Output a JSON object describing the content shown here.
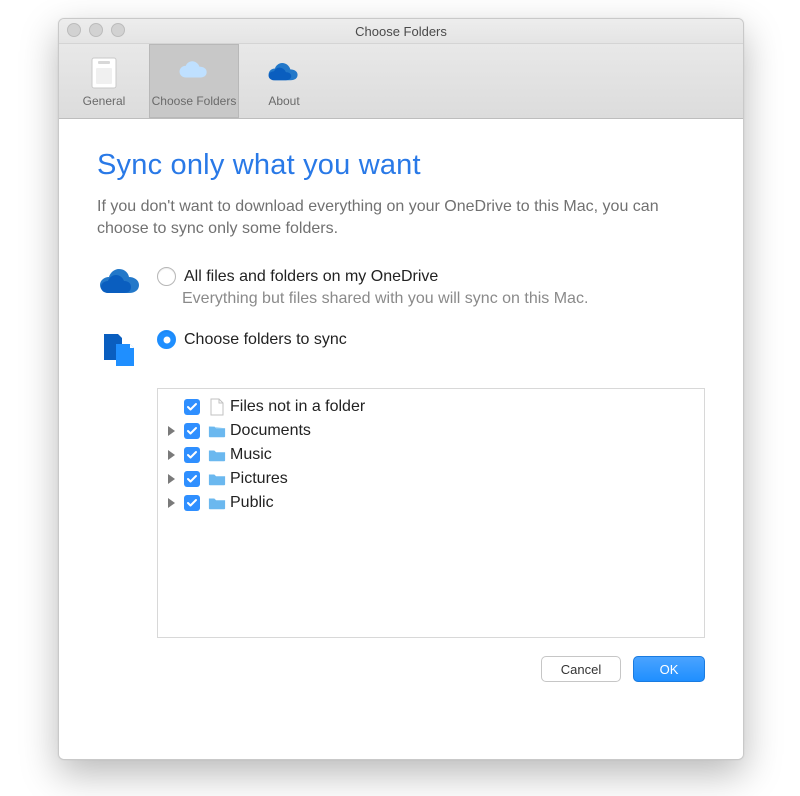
{
  "window": {
    "title": "Choose Folders"
  },
  "toolbar": {
    "tabs": [
      {
        "label": "General"
      },
      {
        "label": "Choose Folders"
      },
      {
        "label": "About"
      }
    ]
  },
  "content": {
    "headline": "Sync only what you want",
    "description": "If you don't want to download everything on your OneDrive to this Mac, you can choose to sync only some folders.",
    "options": {
      "all": {
        "label": "All files and folders on my OneDrive",
        "description": "Everything but files shared with you will sync on this Mac.",
        "selected": false
      },
      "choose": {
        "label": "Choose folders to sync",
        "selected": true
      }
    },
    "tree": [
      {
        "label": "Files not in a folder",
        "expandable": false,
        "checked": true,
        "type": "file"
      },
      {
        "label": "Documents",
        "expandable": true,
        "checked": true,
        "type": "folder"
      },
      {
        "label": "Music",
        "expandable": true,
        "checked": true,
        "type": "folder"
      },
      {
        "label": "Pictures",
        "expandable": true,
        "checked": true,
        "type": "folder"
      },
      {
        "label": "Public",
        "expandable": true,
        "checked": true,
        "type": "folder"
      }
    ]
  },
  "footer": {
    "cancel": "Cancel",
    "ok": "OK"
  },
  "colors": {
    "accent": "#1f8fff",
    "headline": "#2979e7",
    "onedrive": "#0a5ebf",
    "folderIcon": "#6bb8ef"
  }
}
